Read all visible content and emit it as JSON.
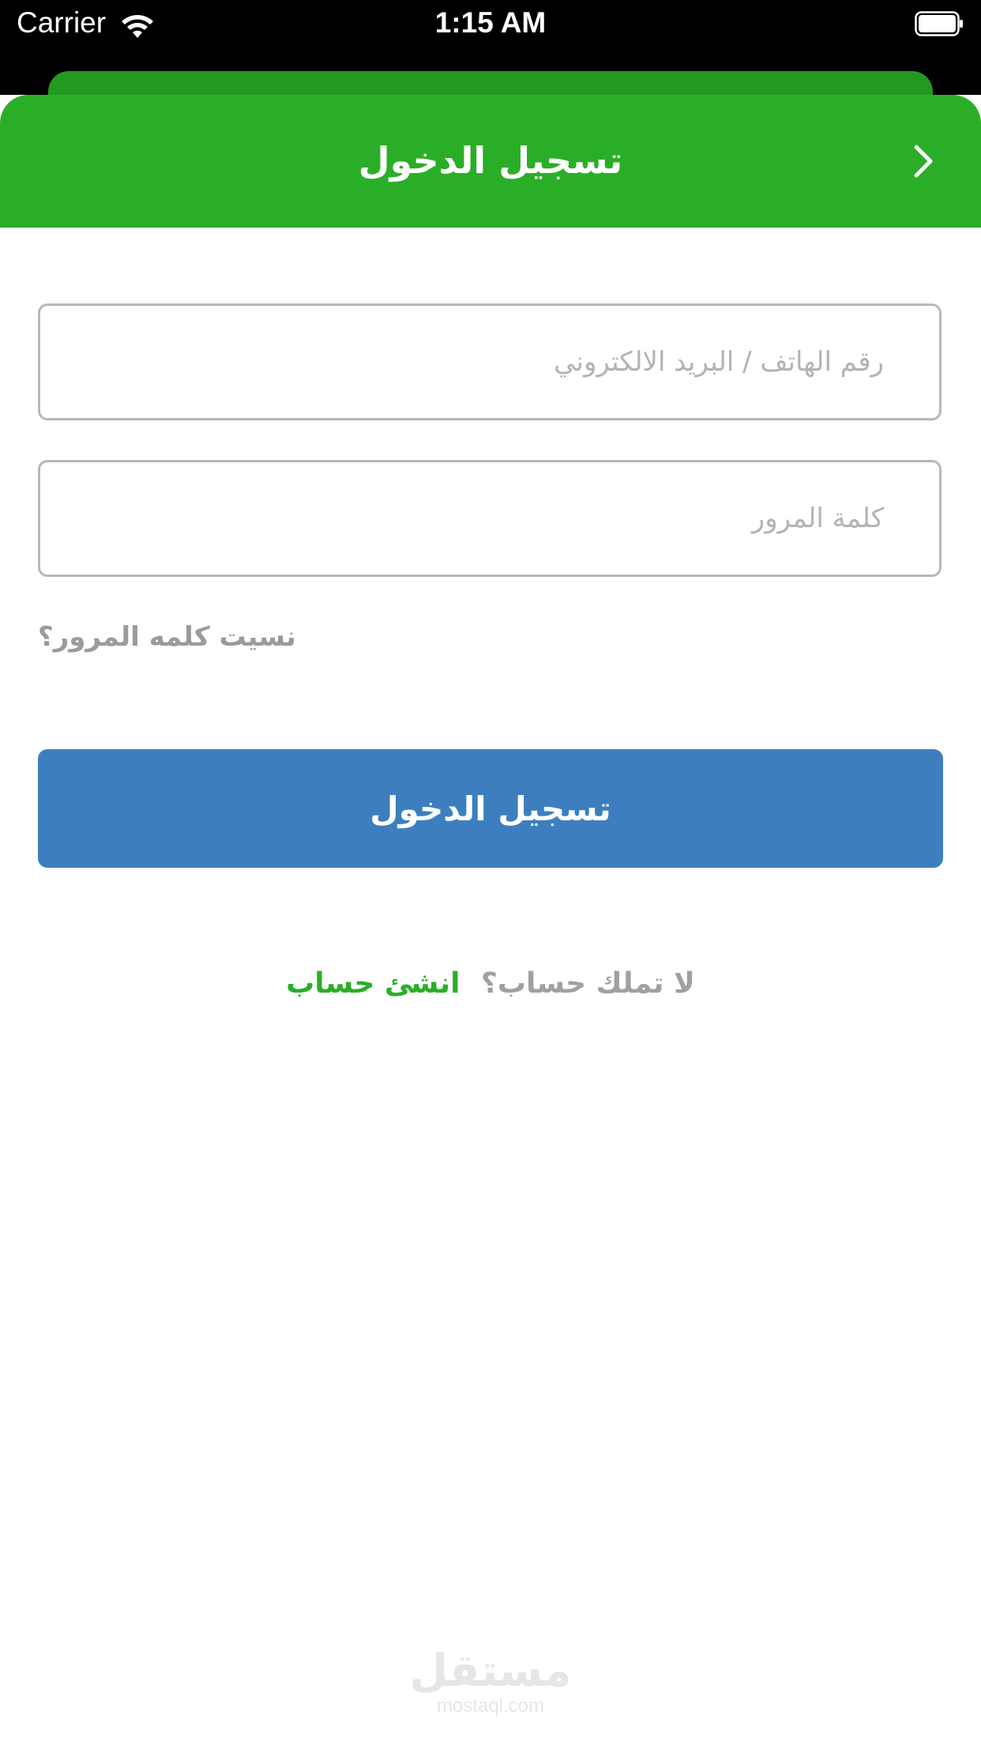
{
  "status_bar": {
    "carrier": "Carrier",
    "time": "1:15 AM",
    "icons": [
      "wifi-icon",
      "battery-icon"
    ]
  },
  "header": {
    "title": "تسجيل الدخول",
    "back_icon": "chevron-right-icon"
  },
  "form": {
    "phone_placeholder": "رقم الهاتف / البريد الالكتروني",
    "password_placeholder": "كلمة المرور",
    "forgot_password": "نسيت كلمه المرور؟",
    "login_button": "تسجيل الدخول"
  },
  "signup": {
    "question": "لا تملك حساب؟",
    "link": "انشئ حساب"
  },
  "watermark": {
    "arabic": "مستقل",
    "latin": "mostaql.com"
  },
  "colors": {
    "header_green": "#2bae27",
    "button_blue": "#3d7fbe",
    "link_green": "#2bae27"
  }
}
